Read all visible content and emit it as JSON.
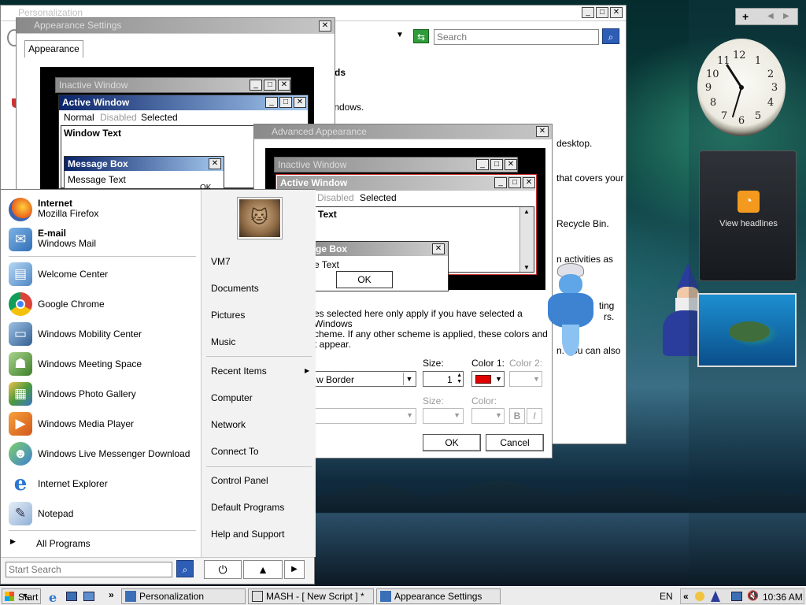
{
  "personalization": {
    "title": "Personalization",
    "search_placeholder": "Search",
    "body_lines": [
      "ds",
      "ur windows.",
      "desktop.",
      "that covers your",
      "Recycle Bin.",
      "n activities as",
      "ting",
      "rs.",
      "n. You can also"
    ]
  },
  "appearance_settings": {
    "title": "Appearance Settings",
    "tab": "Appearance",
    "inactive_title": "Inactive Window",
    "active_title": "Active Window",
    "menu": {
      "normal": "Normal",
      "disabled": "Disabled",
      "selected": "Selected"
    },
    "window_text": "Window Text",
    "msgbox_title": "Message Box",
    "msgbox_text": "Message Text",
    "msgbox_ok": "OK"
  },
  "advanced_appearance": {
    "title": "Advanced Appearance",
    "inactive_title": "Inactive Window",
    "active_title": "Active Window",
    "menu": {
      "disabled": "Disabled",
      "selected": "Selected"
    },
    "window_text": "r Text",
    "msgbox_title": "ge Box",
    "msgbox_text": "e Text",
    "msgbox_ok": "OK",
    "info_lines": [
      "es selected here only apply if you have selected a Windows",
      "cheme. If any other scheme is applied, these colors and",
      "t appear."
    ],
    "size_label": "Size:",
    "color1_label": "Color 1:",
    "color2_label": "Color 2:",
    "size2_label": "Size:",
    "color_label": "Color:",
    "item_value": "w Border",
    "size_value": "1",
    "color1_value": "#e00000",
    "bold_label": "B",
    "italic_label": "I",
    "ok_label": "OK",
    "cancel_label": "Cancel"
  },
  "start_menu": {
    "pinned": [
      {
        "title": "Internet",
        "subtitle": "Mozilla Firefox",
        "icon": "firefox-icon"
      },
      {
        "title": "E-mail",
        "subtitle": "Windows Mail",
        "icon": "mail-icon"
      }
    ],
    "recent": [
      {
        "label": "Welcome Center",
        "icon": "welcome-center-icon"
      },
      {
        "label": "Google Chrome",
        "icon": "chrome-icon"
      },
      {
        "label": "Windows Mobility Center",
        "icon": "mobility-center-icon"
      },
      {
        "label": "Windows Meeting Space",
        "icon": "meeting-space-icon"
      },
      {
        "label": "Windows Photo Gallery",
        "icon": "photo-gallery-icon"
      },
      {
        "label": "Windows Media Player",
        "icon": "media-player-icon"
      },
      {
        "label": "Windows Live Messenger Download",
        "icon": "messenger-icon"
      },
      {
        "label": "Internet Explorer",
        "icon": "internet-explorer-icon"
      },
      {
        "label": "Notepad",
        "icon": "notepad-icon"
      }
    ],
    "all_programs": "All Programs",
    "search_placeholder": "Start Search",
    "right": {
      "user": "VM7",
      "documents": "Documents",
      "pictures": "Pictures",
      "music": "Music",
      "recent_items": "Recent Items",
      "computer": "Computer",
      "network": "Network",
      "connect_to": "Connect To",
      "control_panel": "Control Panel",
      "default_programs": "Default Programs",
      "help_support": "Help and Support"
    }
  },
  "taskbar": {
    "start": "Start",
    "tasks": [
      "Personalization",
      "MASH - [ New Script ] *",
      "Appearance Settings"
    ],
    "language": "EN",
    "time": "10:36 AM"
  },
  "sidebar": {
    "add": "+",
    "feed_label": "View headlines",
    "clock_numbers": [
      "12",
      "1",
      "2",
      "3",
      "4",
      "5",
      "6",
      "7",
      "8",
      "9",
      "10",
      "11"
    ]
  },
  "colors": {
    "accent": "#0a246a",
    "feed_orange": "#f39a1e"
  }
}
